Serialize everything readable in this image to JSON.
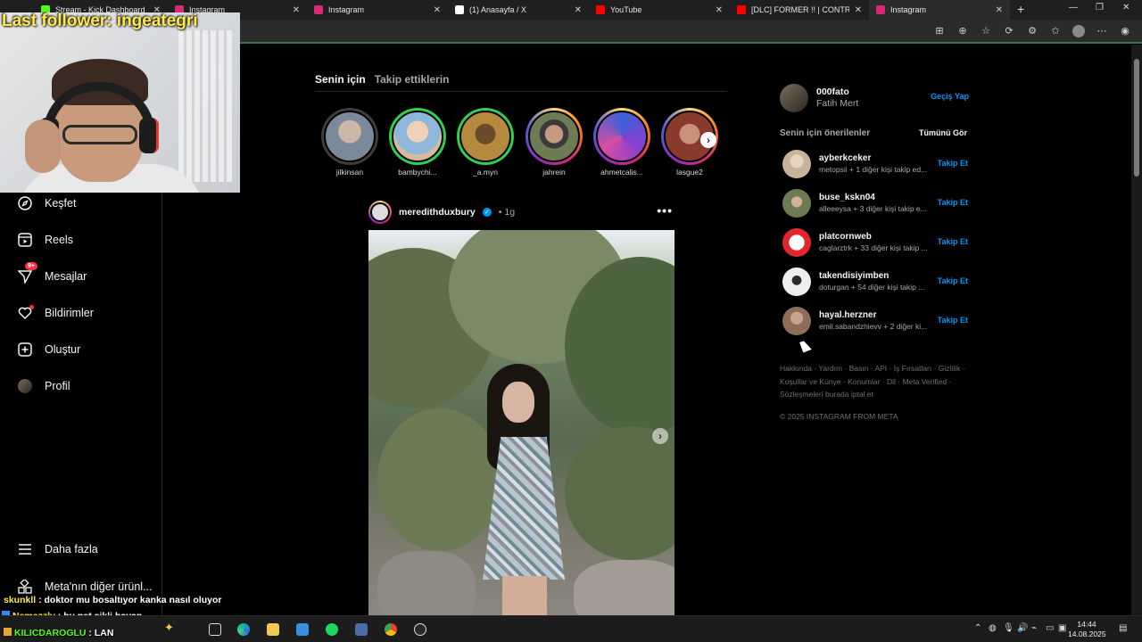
{
  "browser": {
    "tabs": [
      {
        "title": "Stream - Kick Dashboard",
        "favicon_color": "#53fc18"
      },
      {
        "title": "Instagram",
        "favicon_color": "#d62976"
      },
      {
        "title": "Instagram",
        "favicon_color": "#d62976"
      },
      {
        "title": "(1) Anasayfa / X",
        "favicon_color": "#ffffff"
      },
      {
        "title": "YouTube",
        "favicon_color": "#ff0000"
      },
      {
        "title": "[DLC] FORMER !! | CONTROL: TH",
        "favicon_color": "#ff0000"
      },
      {
        "title": "Instagram",
        "favicon_color": "#d62976"
      }
    ],
    "new_tab": "+",
    "window_controls": {
      "minimize": "—",
      "restore": "❐",
      "close": "✕"
    }
  },
  "overlay": {
    "last_follower": "Last follower: ingeategri",
    "chat": [
      {
        "user": "skunkll",
        "message": " : doktor mu bosaltıyor kanka nasıl oluyor"
      },
      {
        "user": "Nemezzly",
        "message": " : bu net sikli bayan"
      },
      {
        "user": "KILICDAROGLU",
        "message": " : LAN"
      }
    ]
  },
  "nav": {
    "items": [
      {
        "label": "Keşfet",
        "icon": "compass-icon"
      },
      {
        "label": "Reels",
        "icon": "reels-icon"
      },
      {
        "label": "Mesajlar",
        "icon": "messenger-icon",
        "badge": "9+"
      },
      {
        "label": "Bildirimler",
        "icon": "heart-icon"
      },
      {
        "label": "Oluştur",
        "icon": "plus-square-icon"
      },
      {
        "label": "Profil",
        "icon": "avatar"
      }
    ],
    "more": "Daha fazla",
    "meta": "Meta'nın diğer ürünl..."
  },
  "feed": {
    "tabs": [
      "Senin için",
      "Takip ettiklerin"
    ],
    "stories": [
      {
        "user": "jilkinsan",
        "ring": "gray",
        "color": "#7b8a9a"
      },
      {
        "user": "bambychi...",
        "ring": "green",
        "color": "#d7b9a0"
      },
      {
        "user": "_a.myn",
        "ring": "green",
        "color": "#b58a3e"
      },
      {
        "user": "jahrein",
        "ring": "grad",
        "color": "#6d7c55"
      },
      {
        "user": "ahmetcalis...",
        "ring": "grad",
        "color": "#6a5aa8"
      },
      {
        "user": "lasgue2",
        "ring": "grad",
        "color": "#8a3a2c"
      }
    ],
    "post": {
      "user": "meredithduxbury",
      "verified": "✓",
      "time": "• 1g",
      "more": "•••"
    }
  },
  "sidebar": {
    "me": {
      "username": "000fato",
      "name": "Fatih Mert",
      "switch": "Geçiş Yap"
    },
    "suggestions_title": "Senin için önerilenler",
    "see_all": "Tümünü Gör",
    "suggestions": [
      {
        "username": "ayberkceker",
        "detail": "metopsii + 1 diğer kişi takip ed...",
        "follow": "Takip Et",
        "color": "#c8b39a"
      },
      {
        "username": "buse_kskn04",
        "detail": "alleeeysa + 3 diğer kişi takip e...",
        "follow": "Takip Et",
        "color": "#6d7a52"
      },
      {
        "username": "platcornweb",
        "detail": "caglarztrk + 33 diğer kişi takip ...",
        "follow": "Takip Et",
        "color": "#e3262b"
      },
      {
        "username": "takendisiyimben",
        "detail": "doturgan + 54 diğer kişi takip ...",
        "follow": "Takip Et",
        "color": "#eeeeee"
      },
      {
        "username": "hayal.herzner",
        "detail": "emil.sabandzhievv + 2 diğer ki...",
        "follow": "Takip Et",
        "color": "#8c6e5a"
      }
    ],
    "footer_links": "Hakkında · Yardım · Basın · API · İş Fırsatları · Gizlilik · Koşullar ve Künye · Konumlar · Dil · Meta Verified · Sözleşmeleri burada iptal et",
    "copyright": "© 2025 INSTAGRAM FROM META"
  },
  "taskbar": {
    "time": "14:44",
    "date": "14.08.2025"
  }
}
